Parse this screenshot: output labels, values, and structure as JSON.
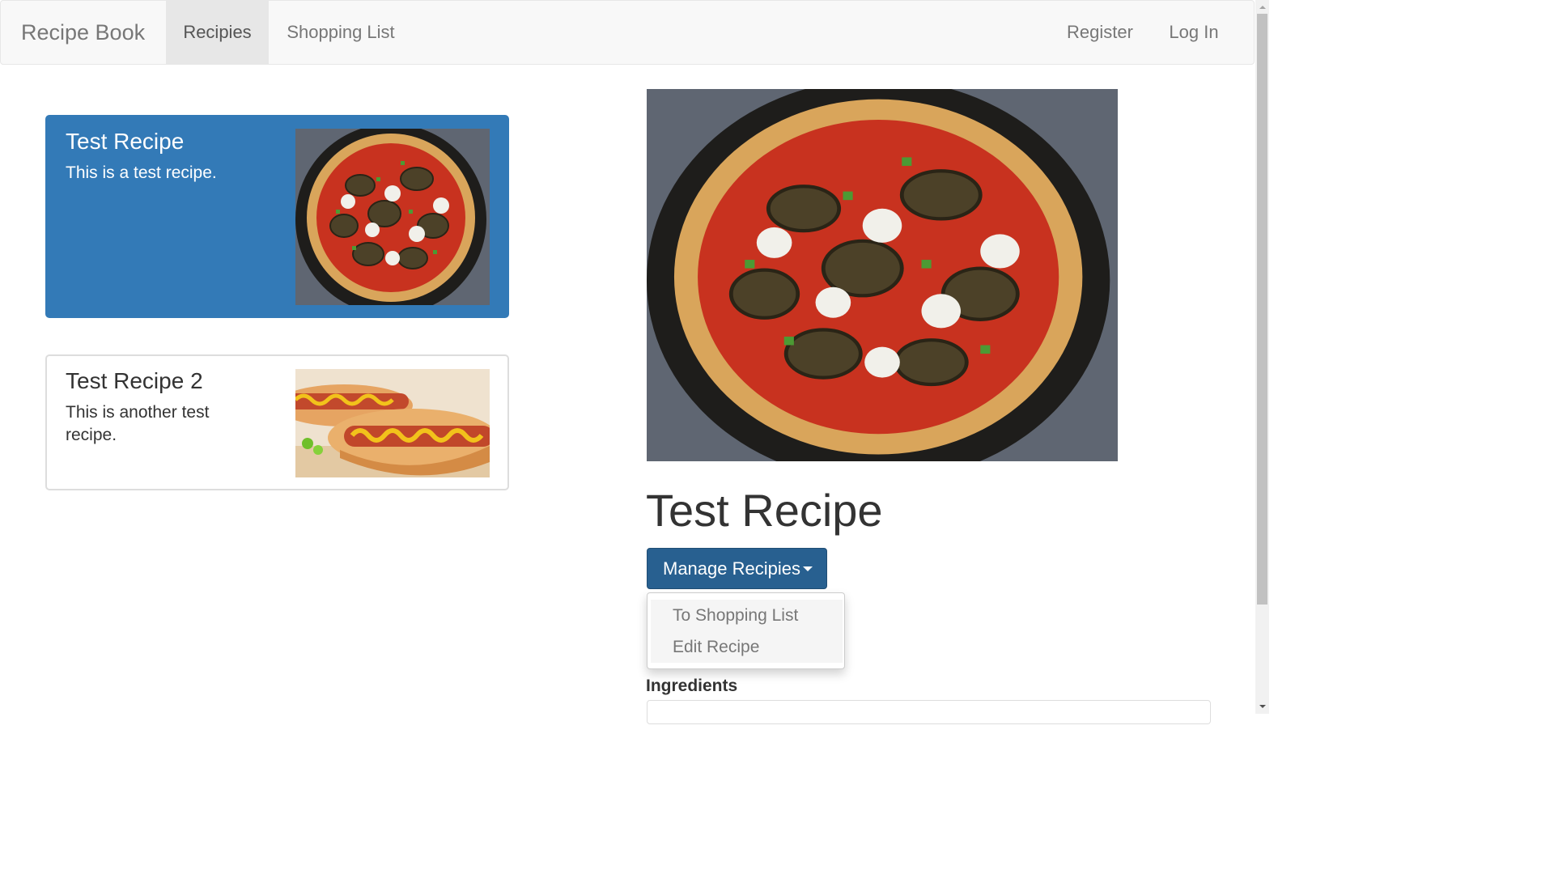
{
  "navbar": {
    "brand": "Recipe Book",
    "links": [
      {
        "label": "Recipies",
        "active": true
      },
      {
        "label": "Shopping List",
        "active": false
      }
    ],
    "right_links": [
      {
        "label": "Register"
      },
      {
        "label": "Log In"
      }
    ]
  },
  "recipes": [
    {
      "name": "Test Recipe",
      "description": "This is a test recipe.",
      "active": true,
      "image": "pizza-image"
    },
    {
      "name": "Test Recipe 2",
      "description": "This is another test recipe.",
      "active": false,
      "image": "hotdog-image"
    }
  ],
  "detail": {
    "title": "Test Recipe",
    "image": "pizza-image",
    "manage_button": "Manage Recipies",
    "dropdown": [
      "To Shopping List",
      "Edit Recipe"
    ],
    "ingredients_label": "Ingredients"
  },
  "colors": {
    "active_blue": "#337ab7",
    "button_blue": "#286090",
    "navbar_bg": "#f8f8f8"
  }
}
